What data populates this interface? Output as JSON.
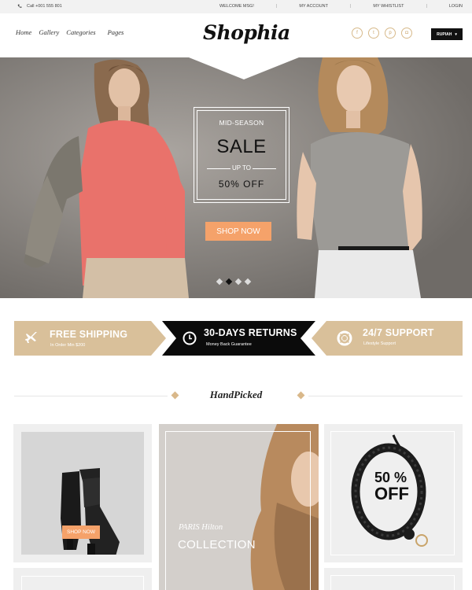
{
  "topbar": {
    "phone": "Call +001 555 801",
    "links": [
      "WELCOME MSG!",
      "MY ACCOUNT",
      "MY WHISTLIST",
      "LOGIN"
    ]
  },
  "header": {
    "nav": [
      "Home",
      "Gallery",
      "Categories",
      "Pages"
    ],
    "logo": "Shophia",
    "socials": [
      "facebook-icon",
      "twitter-icon",
      "pinterest-icon",
      "instagram-icon"
    ],
    "currency": "RUPIAH"
  },
  "hero": {
    "mid_season": "MID-SEASON",
    "sale": "SALE",
    "up_to": "UP TO",
    "discount": "50% OFF",
    "cta": "SHOP NOW",
    "slides": 4,
    "active_slide": 2
  },
  "features": [
    {
      "title": "FREE SHIPPING",
      "sub": "In Order Min $200",
      "icon": "airplane-icon"
    },
    {
      "title": "30-DAYS RETURNS",
      "sub": "Money Back Guarantee",
      "icon": "clock-icon"
    },
    {
      "title": "24/7 SUPPORT",
      "sub": "Lifestyle Support",
      "icon": "lifebuoy-icon"
    }
  ],
  "handpicked": {
    "title": "HandPicked"
  },
  "products": {
    "boots_cta": "SHOP NOW",
    "collection_brand": "PARIS Hilton",
    "collection_title": "COLLECTION",
    "bracelet_percent": "50 %",
    "bracelet_off": "OFF"
  },
  "colors": {
    "accent": "#d9c09a",
    "cta": "#f5a26a",
    "dark": "#111111"
  }
}
